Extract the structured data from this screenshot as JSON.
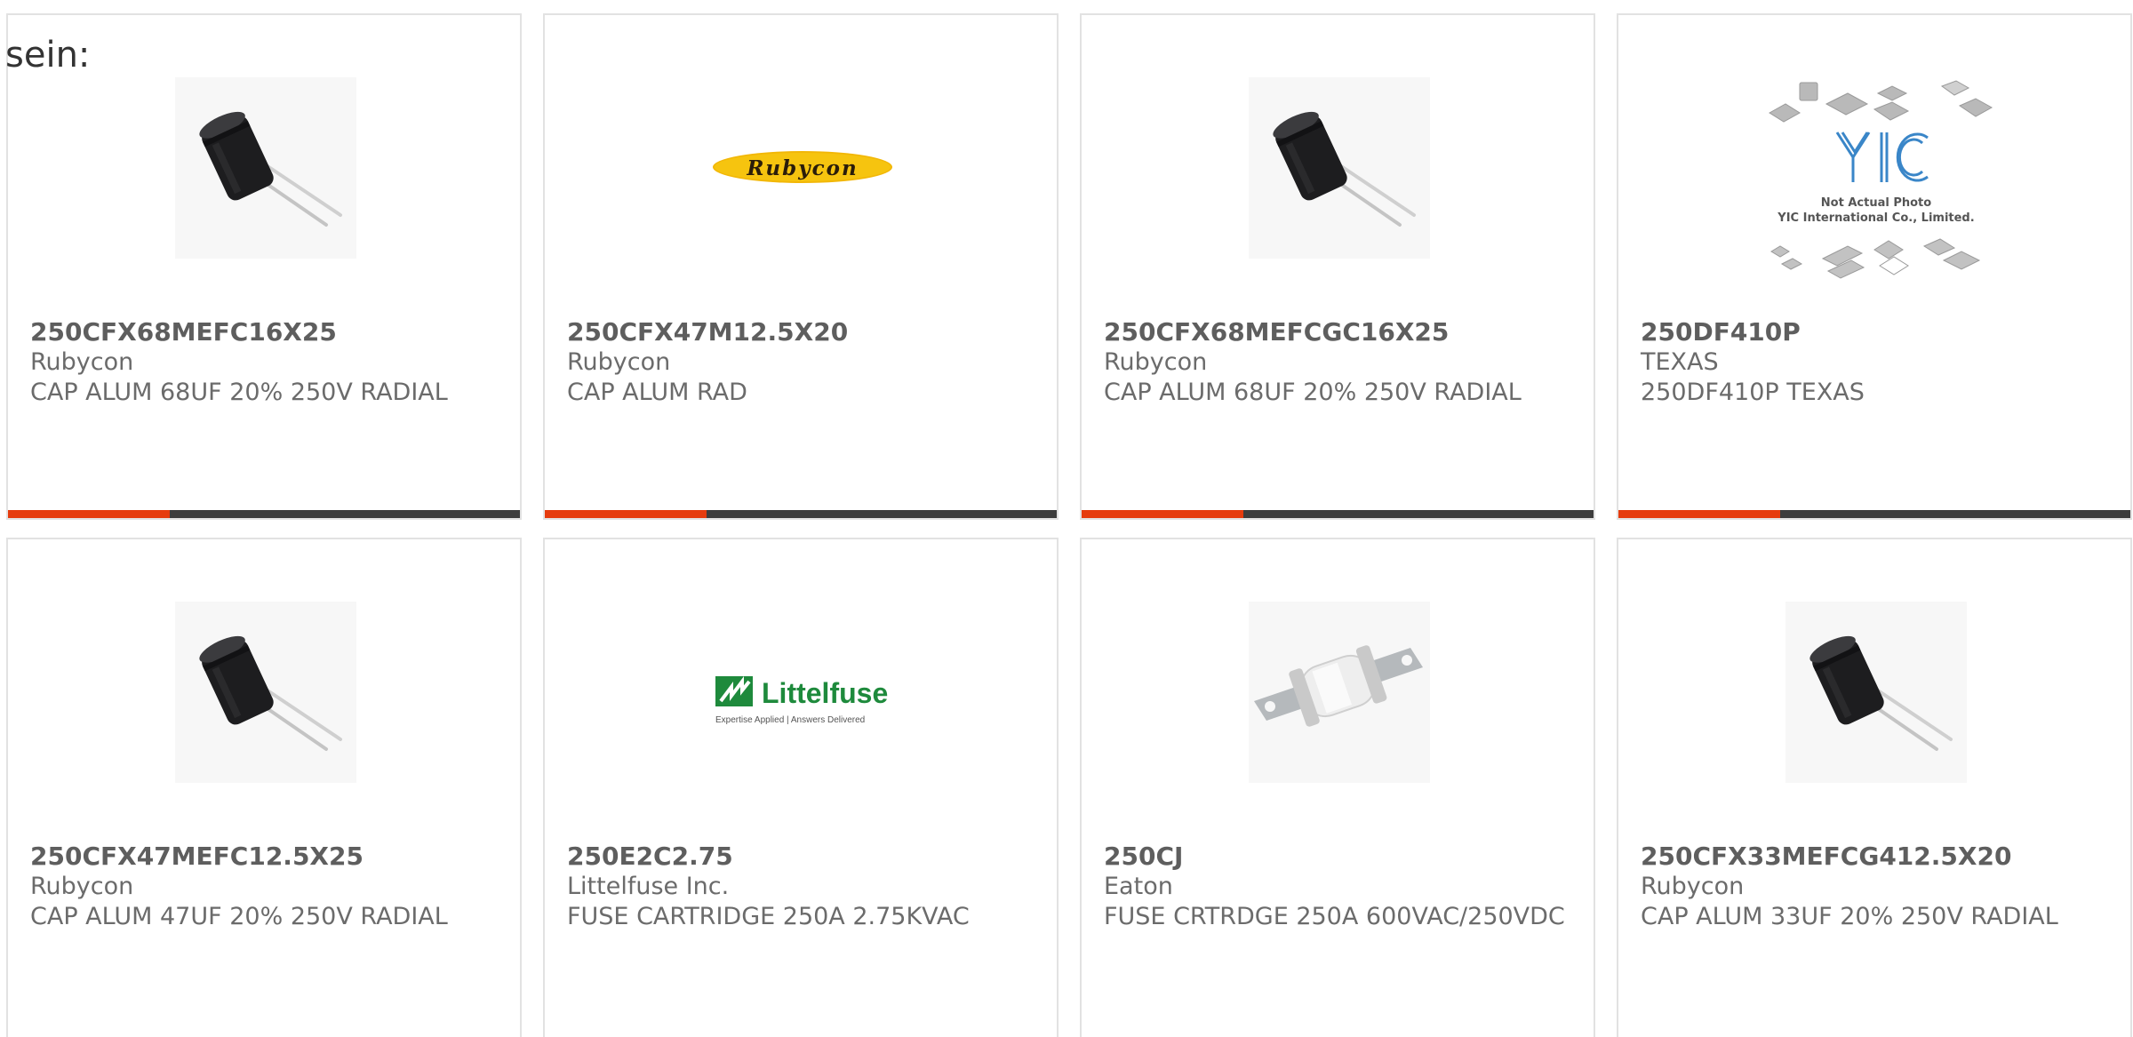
{
  "intro_text": "sein:",
  "colors": {
    "card_border": "#e2e2e2",
    "accent": "#e63c0e",
    "bar_dark": "#3d3d3d",
    "text": "#6b6b6b"
  },
  "products": [
    {
      "part_number": "250CFX68MEFC16X25",
      "manufacturer": "Rubycon",
      "description": "CAP ALUM 68UF 20% 250V RADIAL",
      "image": "radial-capacitor-photo"
    },
    {
      "part_number": "250CFX47M12.5X20",
      "manufacturer": "Rubycon",
      "description": "CAP ALUM RAD",
      "image": "rubycon-logo",
      "logo_text": "Rubycon"
    },
    {
      "part_number": "250CFX68MEFCGC16X25",
      "manufacturer": "Rubycon",
      "description": "CAP ALUM 68UF 20% 250V RADIAL",
      "image": "radial-capacitor-photo"
    },
    {
      "part_number": "250DF410P",
      "manufacturer": "TEXAS",
      "description": "250DF410P TEXAS",
      "image": "yic-placeholder",
      "placeholder_lines": [
        "Not Actual Photo",
        "YIC International Co., Limited."
      ]
    },
    {
      "part_number": "250CFX47MEFC12.5X25",
      "manufacturer": "Rubycon",
      "description": "CAP ALUM 47UF 20% 250V RADIAL",
      "image": "radial-capacitor-photo"
    },
    {
      "part_number": "250E2C2.75",
      "manufacturer": "Littelfuse Inc.",
      "description": "FUSE CARTRIDGE 250A 2.75KVAC",
      "image": "littelfuse-logo",
      "logo_text": "Littelfuse",
      "logo_tagline": "Expertise Applied | Answers Delivered"
    },
    {
      "part_number": "250CJ",
      "manufacturer": "Eaton",
      "description": "FUSE CRTRDGE 250A 600VAC/250VDC",
      "image": "fuse-cartridge-photo"
    },
    {
      "part_number": "250CFX33MEFCG412.5X20",
      "manufacturer": "Rubycon",
      "description": "CAP ALUM 33UF 20% 250V RADIAL",
      "image": "radial-capacitor-photo"
    }
  ]
}
